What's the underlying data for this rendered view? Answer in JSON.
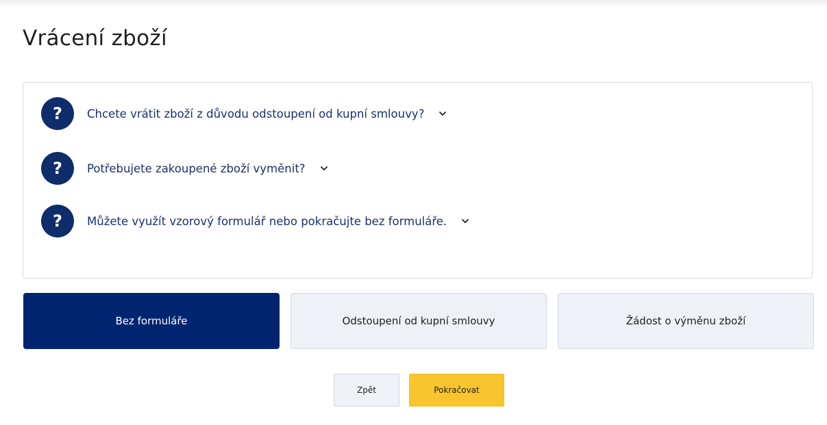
{
  "page": {
    "title": "Vrácení zboží"
  },
  "faq": {
    "icon": "question-icon",
    "items": [
      {
        "label": "Chcete vrátit zboží z důvodu odstoupení od kupní smlouvy?",
        "icon_glyph": "?"
      },
      {
        "label": "Potřebujete zakoupené zboží vyměnit?",
        "icon_glyph": "?"
      },
      {
        "label": "Můžete využít vzorový formulář nebo pokračujte bez formuláře.",
        "icon_glyph": "?"
      }
    ]
  },
  "options": [
    {
      "label": "Bez formuláře",
      "selected": true
    },
    {
      "label": "Odstoupení od kupní smlouvy",
      "selected": false
    },
    {
      "label": "Žádost o výměnu zboží",
      "selected": false
    }
  ],
  "actions": {
    "back_label": "Zpět",
    "continue_label": "Pokračovat"
  },
  "colors": {
    "brand_navy": "#002570",
    "icon_navy": "#0f2d6b",
    "link_text": "#1b2f6e",
    "accent_yellow": "#f8c52c",
    "option_bg": "#eef1f6"
  }
}
